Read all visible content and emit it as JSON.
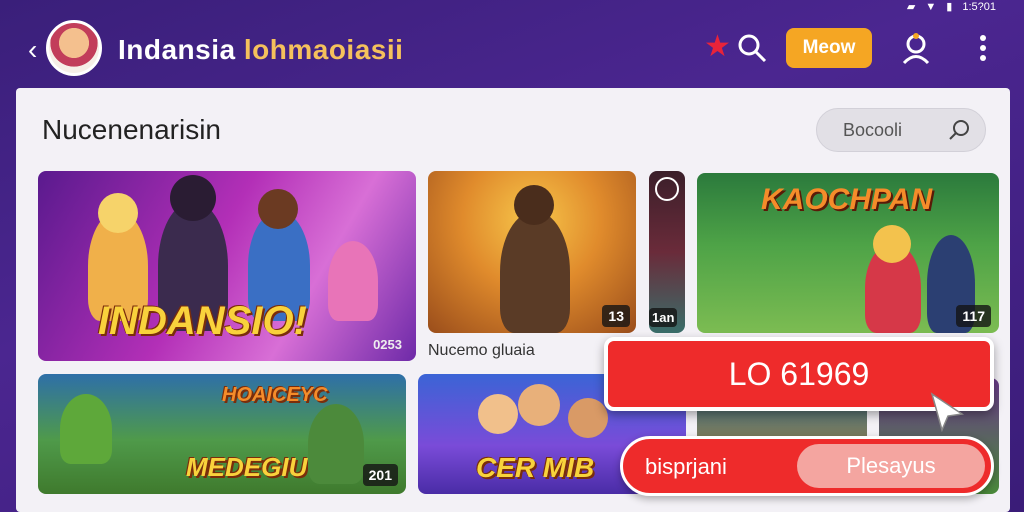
{
  "statusbar": {
    "time": "1:5?01"
  },
  "header": {
    "title_part1": "Indansia ",
    "title_part2": "lohmaoiasii",
    "menu_button": "Meow"
  },
  "panel": {
    "title": "Nucenenarisin",
    "search_placeholder": "Bocooli"
  },
  "cards": [
    {
      "title_art": "INDANSIO!",
      "badge": "0253",
      "caption": ""
    },
    {
      "title_art": "",
      "badge": "13",
      "caption": "Nucemo gluaia"
    },
    {
      "title_art": "",
      "badge": "1an",
      "caption": ""
    },
    {
      "title_art": "KAOCHPAN",
      "badge": "117",
      "caption": ""
    },
    {
      "title_art": "MEDEGIU",
      "badge": "201",
      "caption": ""
    },
    {
      "title_art": "CER MIB",
      "badge": "",
      "caption": ""
    }
  ],
  "overlay": {
    "primary_text": "LO 61969",
    "secondary_left": "bisprjani",
    "secondary_right": "Plesayus"
  },
  "colors": {
    "header_bg": "#4b2690",
    "accent": "#f5a623",
    "overlay_red": "#ee2b2b",
    "panel_bg": "#f3f1f6"
  },
  "icons": [
    "back-arrow-icon",
    "star-icon",
    "search-icon",
    "profile-icon",
    "more-vert-icon"
  ]
}
